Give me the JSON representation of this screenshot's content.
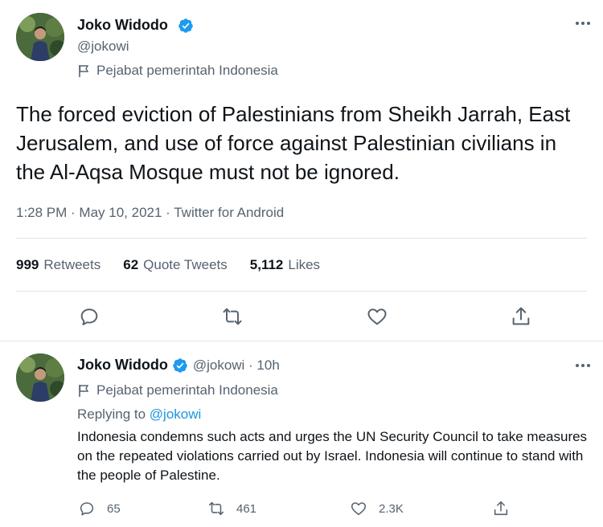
{
  "main_tweet": {
    "author_name": "Joko Widodo",
    "handle": "@jokowi",
    "label": "Pejabat pemerintah Indonesia",
    "text": "The forced eviction of Palestinians from Sheikh Jarrah, East Jerusalem, and use of force against Palestinian civilians in the Al-Aqsa Mosque must not be ignored.",
    "meta": "1:28 PM · May 10, 2021 · Twitter for Android",
    "stats": {
      "retweets_count": "999",
      "retweets_label": "Retweets",
      "quotes_count": "62",
      "quotes_label": "Quote Tweets",
      "likes_count": "5,112",
      "likes_label": "Likes"
    }
  },
  "reply_tweet": {
    "author_name": "Joko Widodo",
    "handle_time": "@jokowi · 10h",
    "label": "Pejabat pemerintah Indonesia",
    "replying_prefix": "Replying to",
    "replying_handle": "@jokowi",
    "text": "Indonesia condemns such acts and urges the UN Security Council to take measures on the repeated violations carried out by Israel. Indonesia will continue to stand with the people of Palestine.",
    "actions": {
      "reply_count": "65",
      "retweet_count": "461",
      "like_count": "2.3K"
    }
  },
  "colors": {
    "text_primary": "#0f1419",
    "text_secondary": "#566370",
    "link": "#1b95e0",
    "verified": "#1d9bf0",
    "divider": "#e1e6ea"
  },
  "icons": [
    "verified-badge-icon",
    "government-label-icon",
    "more-icon",
    "reply-icon",
    "retweet-icon",
    "like-icon",
    "share-icon"
  ]
}
